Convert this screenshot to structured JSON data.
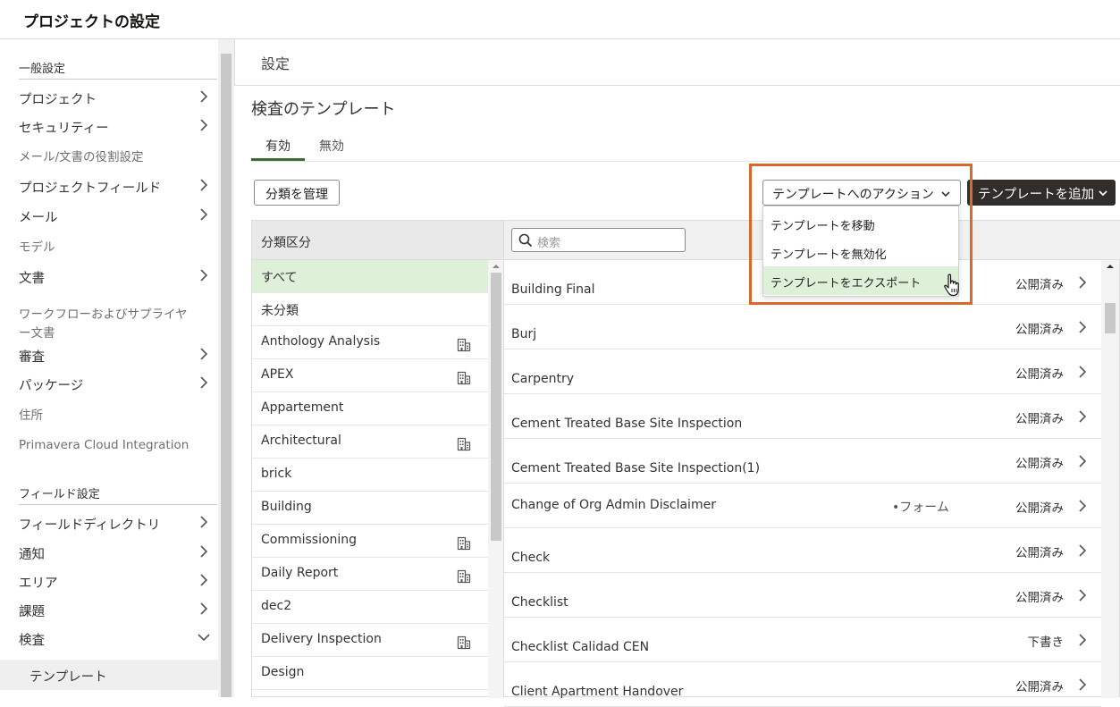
{
  "app": {
    "title": "プロジェクトの設定"
  },
  "sidebar": {
    "section_general": "一般設定",
    "general_items": [
      {
        "label": "プロジェクト",
        "chevron": "right"
      },
      {
        "label": "セキュリティー",
        "chevron": "right"
      },
      {
        "label": "メール/文書の役割設定",
        "chevron": "none"
      },
      {
        "label": "プロジェクトフィールド",
        "chevron": "right"
      },
      {
        "label": "メール",
        "chevron": "right"
      },
      {
        "label": "モデル",
        "chevron": "none"
      },
      {
        "label": "文書",
        "chevron": "right"
      },
      {
        "label": "ワークフローおよびサプライヤ",
        "label2": "ー文書",
        "chevron": "none"
      },
      {
        "label": "審査",
        "chevron": "right"
      },
      {
        "label": "パッケージ",
        "chevron": "right"
      },
      {
        "label": "住所",
        "chevron": "none"
      },
      {
        "label": "Primavera Cloud Integration",
        "chevron": "none"
      }
    ],
    "section_field": "フィールド設定",
    "field_items": [
      {
        "label": "フィールドディレクトリ",
        "chevron": "right"
      },
      {
        "label": "通知",
        "chevron": "right"
      },
      {
        "label": "エリア",
        "chevron": "right"
      },
      {
        "label": "課題",
        "chevron": "right"
      },
      {
        "label": "検査",
        "chevron": "down"
      }
    ],
    "sub_item": {
      "label": "テンプレート"
    }
  },
  "main": {
    "settings_label": "設定",
    "section_title": "検査のテンプレート",
    "tabs": [
      {
        "label": "有効",
        "active": true
      },
      {
        "label": "無効",
        "active": false
      }
    ],
    "manage_button": "分類を管理",
    "actions_button": "テンプレートへのアクション",
    "add_button": "テンプレートを追加",
    "dropdown": [
      {
        "label": "テンプレートを移動"
      },
      {
        "label": "テンプレートを無効化"
      },
      {
        "label": "テンプレートをエクスポート"
      }
    ],
    "category_header": "分類区分",
    "categories": [
      {
        "label": "すべて",
        "icon": false
      },
      {
        "label": "未分類",
        "icon": false
      },
      {
        "label": "Anthology Analysis",
        "icon": true
      },
      {
        "label": "APEX",
        "icon": true
      },
      {
        "label": "Appartement",
        "icon": false
      },
      {
        "label": "Architectural",
        "icon": true
      },
      {
        "label": "brick",
        "icon": false
      },
      {
        "label": "Building",
        "icon": false
      },
      {
        "label": "Commissioning",
        "icon": true
      },
      {
        "label": "Daily Report",
        "icon": true
      },
      {
        "label": "dec2",
        "icon": false
      },
      {
        "label": "Delivery Inspection",
        "icon": true
      },
      {
        "label": "Design",
        "icon": false
      }
    ],
    "search_placeholder": "検索",
    "templates": [
      {
        "name": "Building Final",
        "status": "公開済み",
        "tag": ""
      },
      {
        "name": "Burj",
        "status": "公開済み",
        "tag": ""
      },
      {
        "name": "Carpentry",
        "status": "公開済み",
        "tag": ""
      },
      {
        "name": "Cement Treated Base Site Inspection",
        "status": "公開済み",
        "tag": ""
      },
      {
        "name": "Cement Treated Base Site Inspection(1)",
        "status": "公開済み",
        "tag": ""
      },
      {
        "name": "Change of Org Admin Disclaimer",
        "status": "公開済み",
        "tag": "•フォーム"
      },
      {
        "name": "Check",
        "status": "公開済み",
        "tag": ""
      },
      {
        "name": "Checklist",
        "status": "公開済み",
        "tag": ""
      },
      {
        "name": "Checklist Calidad CEN",
        "status": "下書き",
        "tag": ""
      },
      {
        "name": "Client Apartment Handover",
        "status": "公開済み",
        "tag": ""
      }
    ]
  },
  "colors": {
    "accent": "#3d6a36",
    "highlight": "#d9692a",
    "selected_bg": "#dff0d8",
    "dark_button": "#312d2a"
  }
}
